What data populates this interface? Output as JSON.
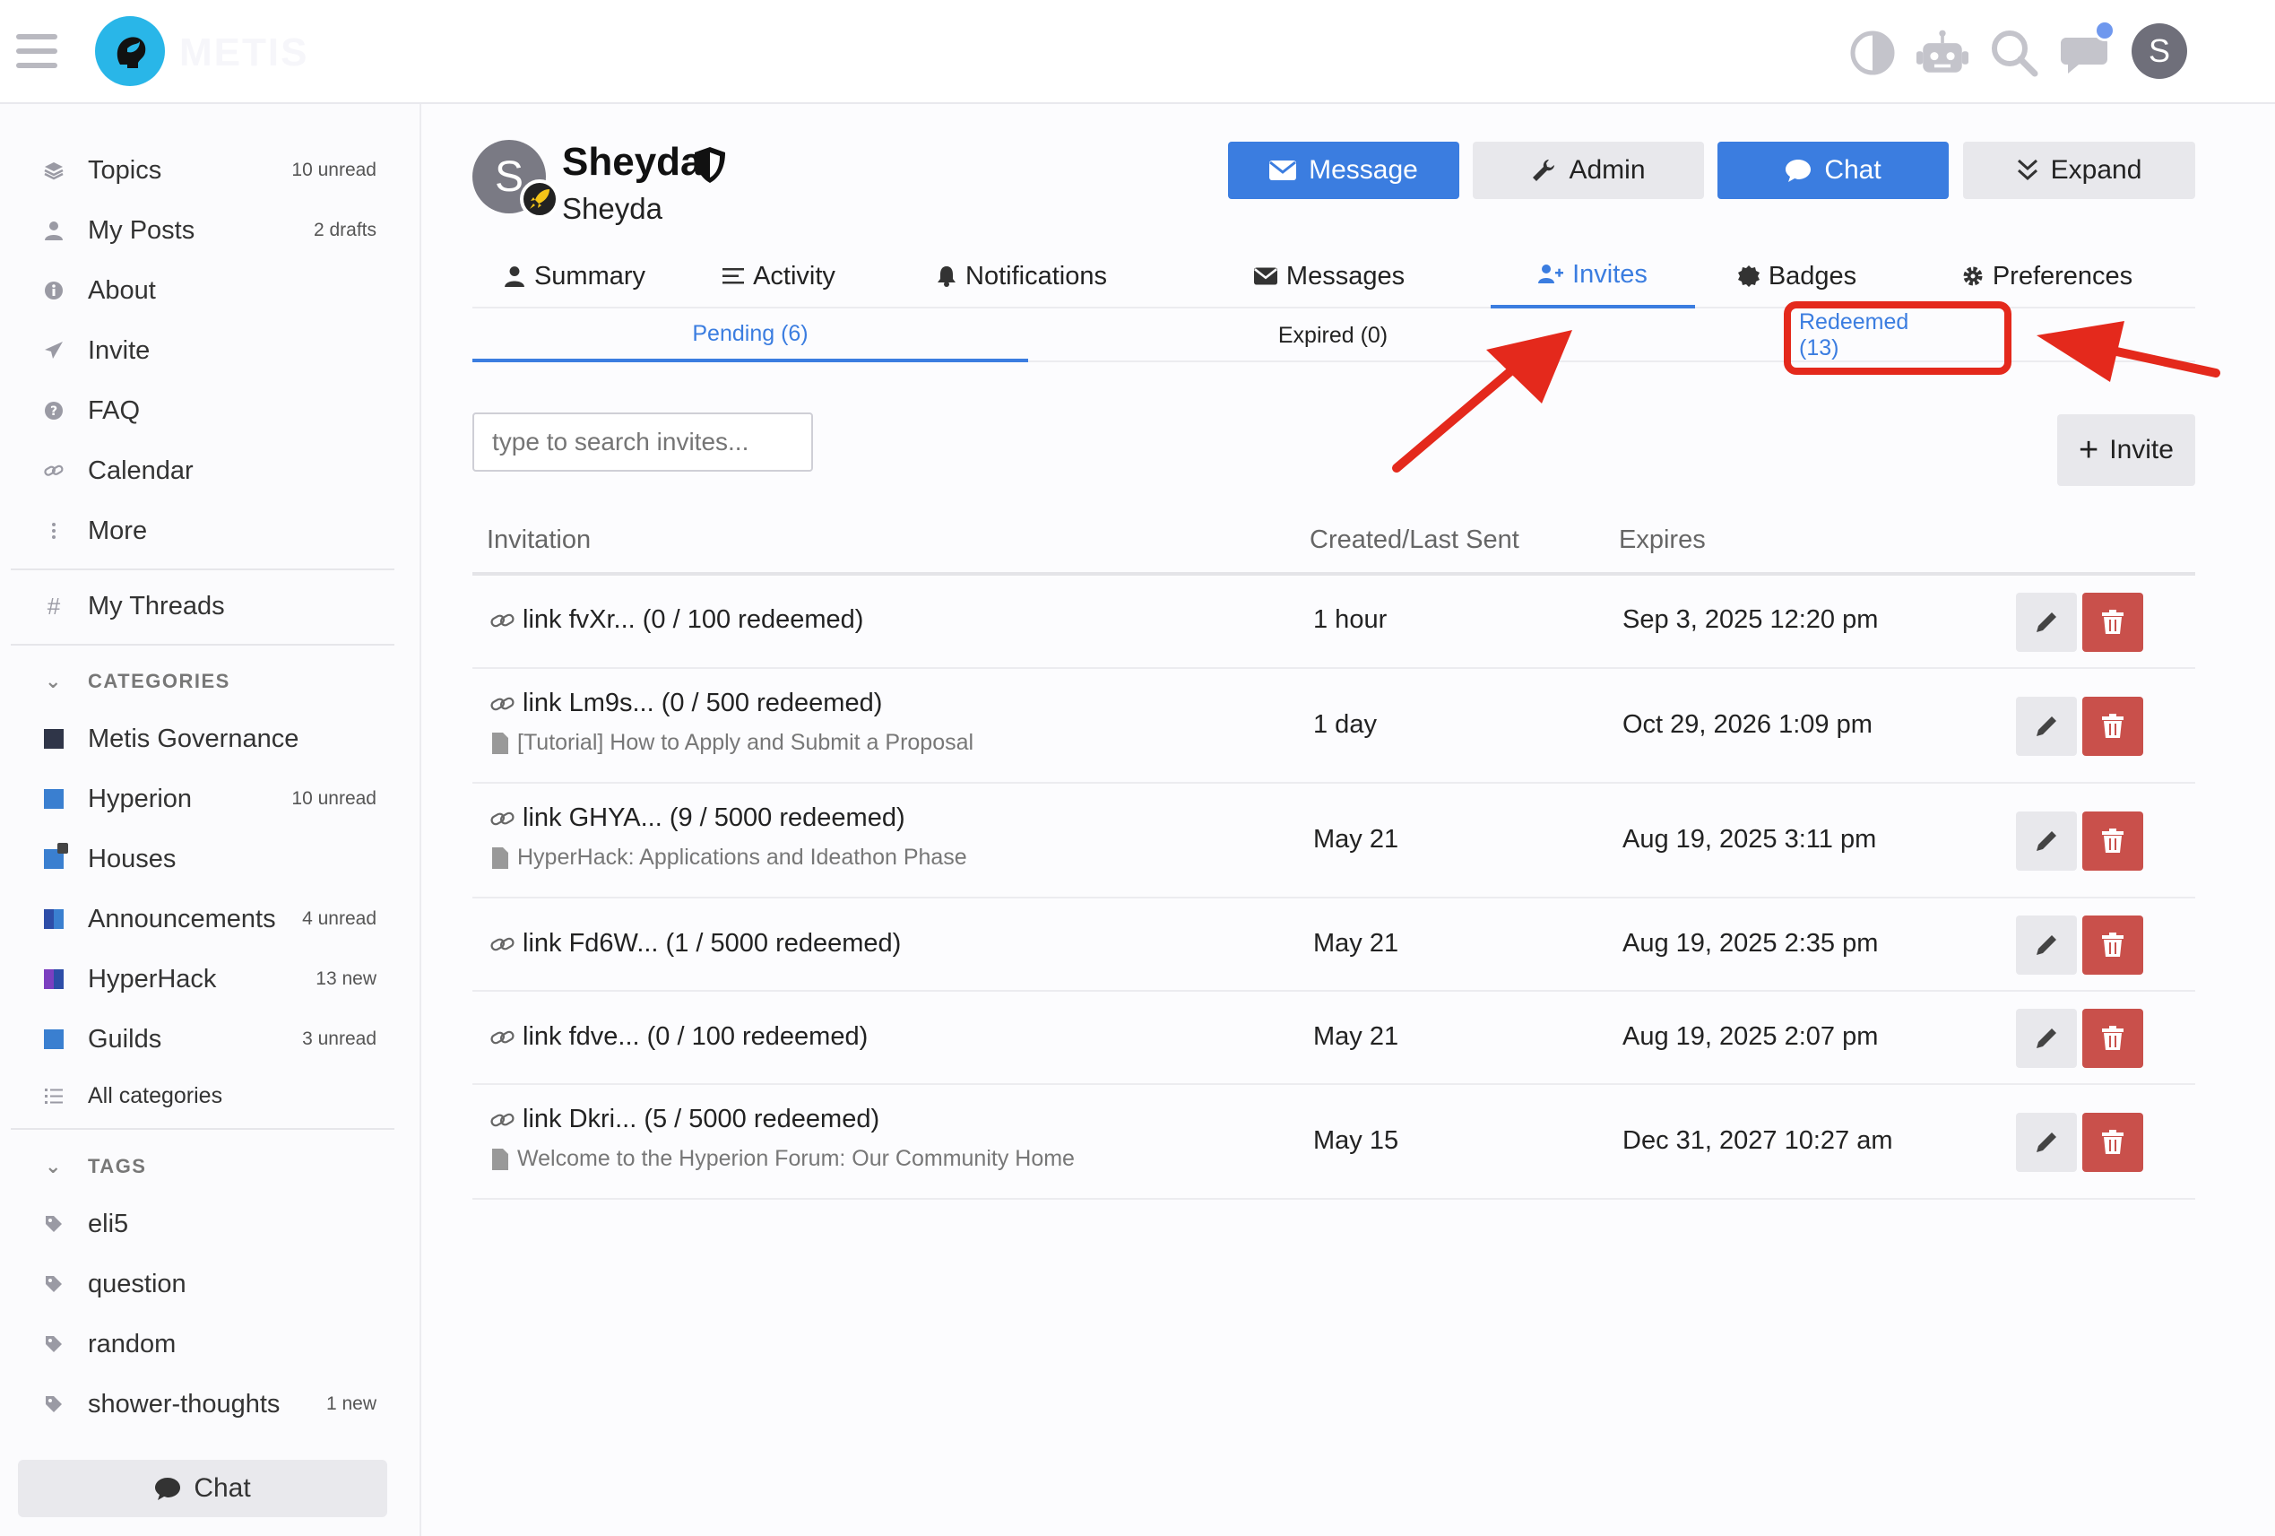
{
  "header": {
    "logo_text": "METIS"
  },
  "sidebar": {
    "items": [
      {
        "label": "Topics",
        "count": "10 unread",
        "icon": "layers-icon"
      },
      {
        "label": "My Posts",
        "count": "2 drafts",
        "icon": "user-icon"
      },
      {
        "label": "About",
        "count": "",
        "icon": "info-icon"
      },
      {
        "label": "Invite",
        "count": "",
        "icon": "paper-plane-icon"
      },
      {
        "label": "FAQ",
        "count": "",
        "icon": "question-icon"
      },
      {
        "label": "Calendar",
        "count": "",
        "icon": "link-icon"
      },
      {
        "label": "More",
        "count": "",
        "icon": "more-vertical-icon"
      }
    ],
    "threads": {
      "label": "My Threads"
    },
    "categories_title": "CATEGORIES",
    "categories": [
      {
        "label": "Metis Governance",
        "count": "",
        "colors": [
          "#2f3548",
          "#2f3548"
        ]
      },
      {
        "label": "Hyperion",
        "count": "10 unread",
        "colors": [
          "#3a7fd0",
          "#3a7fd0"
        ]
      },
      {
        "label": "Houses",
        "count": "",
        "colors": [
          "#3a7fd0",
          "#3a7fd0"
        ]
      },
      {
        "label": "Announcements",
        "count": "4 unread",
        "colors": [
          "#2d4da8",
          "#3a7fd0"
        ]
      },
      {
        "label": "HyperHack",
        "count": "13 new",
        "colors": [
          "#7b3fc0",
          "#2d4da8"
        ]
      },
      {
        "label": "Guilds",
        "count": "3 unread",
        "colors": [
          "#3a7fd0",
          "#3a7fd0"
        ]
      }
    ],
    "all_categories": "All categories",
    "tags_title": "TAGS",
    "tags": [
      {
        "label": "eli5",
        "count": ""
      },
      {
        "label": "question",
        "count": ""
      },
      {
        "label": "random",
        "count": ""
      },
      {
        "label": "shower-thoughts",
        "count": "1 new"
      }
    ],
    "chat_label": "Chat"
  },
  "profile": {
    "avatar_letter": "S",
    "name": "Sheyda",
    "username": "Sheyda",
    "buttons": {
      "message": "Message",
      "admin": "Admin",
      "chat": "Chat",
      "expand": "Expand"
    }
  },
  "tabs": [
    "Summary",
    "Activity",
    "Notifications",
    "Messages",
    "Invites",
    "Badges",
    "Preferences"
  ],
  "subtabs": [
    "Pending (6)",
    "Expired (0)",
    "Redeemed (13)"
  ],
  "search": {
    "placeholder": "type to search invites..."
  },
  "invite_button": "Invite",
  "table": {
    "headers": [
      "Invitation",
      "Created/Last Sent",
      "Expires"
    ],
    "rows": [
      {
        "link": "link fvXr... (0 / 100 redeemed)",
        "topic": "",
        "created": "1 hour",
        "expires": "Sep 3, 2025 12:20 pm"
      },
      {
        "link": "link Lm9s... (0 / 500 redeemed)",
        "topic": "[Tutorial] How to Apply and Submit a Proposal",
        "created": "1 day",
        "expires": "Oct 29, 2026 1:09 pm"
      },
      {
        "link": "link GHYA... (9 / 5000 redeemed)",
        "topic": "HyperHack: Applications and Ideathon Phase",
        "created": "May 21",
        "expires": "Aug 19, 2025 3:11 pm"
      },
      {
        "link": "link Fd6W... (1 / 5000 redeemed)",
        "topic": "",
        "created": "May 21",
        "expires": "Aug 19, 2025 2:35 pm"
      },
      {
        "link": "link fdve... (0 / 100 redeemed)",
        "topic": "",
        "created": "May 21",
        "expires": "Aug 19, 2025 2:07 pm"
      },
      {
        "link": "link Dkri... (5 / 5000 redeemed)",
        "topic": "Welcome to the Hyperion Forum: Our Community Home",
        "created": "May 15",
        "expires": "Dec 31, 2027 10:27 am"
      }
    ]
  },
  "colors": {
    "accent": "#3b7de0",
    "danger": "#c9504b",
    "annotation": "#e4291c"
  }
}
